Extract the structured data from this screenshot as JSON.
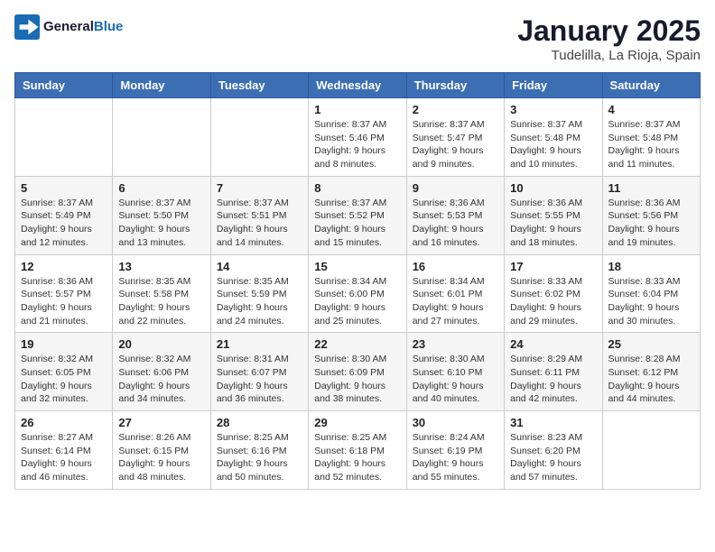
{
  "header": {
    "logo_line1": "General",
    "logo_line2": "Blue",
    "title": "January 2025",
    "subtitle": "Tudelilla, La Rioja, Spain"
  },
  "weekdays": [
    "Sunday",
    "Monday",
    "Tuesday",
    "Wednesday",
    "Thursday",
    "Friday",
    "Saturday"
  ],
  "weeks": [
    [
      {
        "day": "",
        "sunrise": "",
        "sunset": "",
        "daylight": ""
      },
      {
        "day": "",
        "sunrise": "",
        "sunset": "",
        "daylight": ""
      },
      {
        "day": "",
        "sunrise": "",
        "sunset": "",
        "daylight": ""
      },
      {
        "day": "1",
        "sunrise": "Sunrise: 8:37 AM",
        "sunset": "Sunset: 5:46 PM",
        "daylight": "Daylight: 9 hours and 8 minutes."
      },
      {
        "day": "2",
        "sunrise": "Sunrise: 8:37 AM",
        "sunset": "Sunset: 5:47 PM",
        "daylight": "Daylight: 9 hours and 9 minutes."
      },
      {
        "day": "3",
        "sunrise": "Sunrise: 8:37 AM",
        "sunset": "Sunset: 5:48 PM",
        "daylight": "Daylight: 9 hours and 10 minutes."
      },
      {
        "day": "4",
        "sunrise": "Sunrise: 8:37 AM",
        "sunset": "Sunset: 5:48 PM",
        "daylight": "Daylight: 9 hours and 11 minutes."
      }
    ],
    [
      {
        "day": "5",
        "sunrise": "Sunrise: 8:37 AM",
        "sunset": "Sunset: 5:49 PM",
        "daylight": "Daylight: 9 hours and 12 minutes."
      },
      {
        "day": "6",
        "sunrise": "Sunrise: 8:37 AM",
        "sunset": "Sunset: 5:50 PM",
        "daylight": "Daylight: 9 hours and 13 minutes."
      },
      {
        "day": "7",
        "sunrise": "Sunrise: 8:37 AM",
        "sunset": "Sunset: 5:51 PM",
        "daylight": "Daylight: 9 hours and 14 minutes."
      },
      {
        "day": "8",
        "sunrise": "Sunrise: 8:37 AM",
        "sunset": "Sunset: 5:52 PM",
        "daylight": "Daylight: 9 hours and 15 minutes."
      },
      {
        "day": "9",
        "sunrise": "Sunrise: 8:36 AM",
        "sunset": "Sunset: 5:53 PM",
        "daylight": "Daylight: 9 hours and 16 minutes."
      },
      {
        "day": "10",
        "sunrise": "Sunrise: 8:36 AM",
        "sunset": "Sunset: 5:55 PM",
        "daylight": "Daylight: 9 hours and 18 minutes."
      },
      {
        "day": "11",
        "sunrise": "Sunrise: 8:36 AM",
        "sunset": "Sunset: 5:56 PM",
        "daylight": "Daylight: 9 hours and 19 minutes."
      }
    ],
    [
      {
        "day": "12",
        "sunrise": "Sunrise: 8:36 AM",
        "sunset": "Sunset: 5:57 PM",
        "daylight": "Daylight: 9 hours and 21 minutes."
      },
      {
        "day": "13",
        "sunrise": "Sunrise: 8:35 AM",
        "sunset": "Sunset: 5:58 PM",
        "daylight": "Daylight: 9 hours and 22 minutes."
      },
      {
        "day": "14",
        "sunrise": "Sunrise: 8:35 AM",
        "sunset": "Sunset: 5:59 PM",
        "daylight": "Daylight: 9 hours and 24 minutes."
      },
      {
        "day": "15",
        "sunrise": "Sunrise: 8:34 AM",
        "sunset": "Sunset: 6:00 PM",
        "daylight": "Daylight: 9 hours and 25 minutes."
      },
      {
        "day": "16",
        "sunrise": "Sunrise: 8:34 AM",
        "sunset": "Sunset: 6:01 PM",
        "daylight": "Daylight: 9 hours and 27 minutes."
      },
      {
        "day": "17",
        "sunrise": "Sunrise: 8:33 AM",
        "sunset": "Sunset: 6:02 PM",
        "daylight": "Daylight: 9 hours and 29 minutes."
      },
      {
        "day": "18",
        "sunrise": "Sunrise: 8:33 AM",
        "sunset": "Sunset: 6:04 PM",
        "daylight": "Daylight: 9 hours and 30 minutes."
      }
    ],
    [
      {
        "day": "19",
        "sunrise": "Sunrise: 8:32 AM",
        "sunset": "Sunset: 6:05 PM",
        "daylight": "Daylight: 9 hours and 32 minutes."
      },
      {
        "day": "20",
        "sunrise": "Sunrise: 8:32 AM",
        "sunset": "Sunset: 6:06 PM",
        "daylight": "Daylight: 9 hours and 34 minutes."
      },
      {
        "day": "21",
        "sunrise": "Sunrise: 8:31 AM",
        "sunset": "Sunset: 6:07 PM",
        "daylight": "Daylight: 9 hours and 36 minutes."
      },
      {
        "day": "22",
        "sunrise": "Sunrise: 8:30 AM",
        "sunset": "Sunset: 6:09 PM",
        "daylight": "Daylight: 9 hours and 38 minutes."
      },
      {
        "day": "23",
        "sunrise": "Sunrise: 8:30 AM",
        "sunset": "Sunset: 6:10 PM",
        "daylight": "Daylight: 9 hours and 40 minutes."
      },
      {
        "day": "24",
        "sunrise": "Sunrise: 8:29 AM",
        "sunset": "Sunset: 6:11 PM",
        "daylight": "Daylight: 9 hours and 42 minutes."
      },
      {
        "day": "25",
        "sunrise": "Sunrise: 8:28 AM",
        "sunset": "Sunset: 6:12 PM",
        "daylight": "Daylight: 9 hours and 44 minutes."
      }
    ],
    [
      {
        "day": "26",
        "sunrise": "Sunrise: 8:27 AM",
        "sunset": "Sunset: 6:14 PM",
        "daylight": "Daylight: 9 hours and 46 minutes."
      },
      {
        "day": "27",
        "sunrise": "Sunrise: 8:26 AM",
        "sunset": "Sunset: 6:15 PM",
        "daylight": "Daylight: 9 hours and 48 minutes."
      },
      {
        "day": "28",
        "sunrise": "Sunrise: 8:25 AM",
        "sunset": "Sunset: 6:16 PM",
        "daylight": "Daylight: 9 hours and 50 minutes."
      },
      {
        "day": "29",
        "sunrise": "Sunrise: 8:25 AM",
        "sunset": "Sunset: 6:18 PM",
        "daylight": "Daylight: 9 hours and 52 minutes."
      },
      {
        "day": "30",
        "sunrise": "Sunrise: 8:24 AM",
        "sunset": "Sunset: 6:19 PM",
        "daylight": "Daylight: 9 hours and 55 minutes."
      },
      {
        "day": "31",
        "sunrise": "Sunrise: 8:23 AM",
        "sunset": "Sunset: 6:20 PM",
        "daylight": "Daylight: 9 hours and 57 minutes."
      },
      {
        "day": "",
        "sunrise": "",
        "sunset": "",
        "daylight": ""
      }
    ]
  ]
}
